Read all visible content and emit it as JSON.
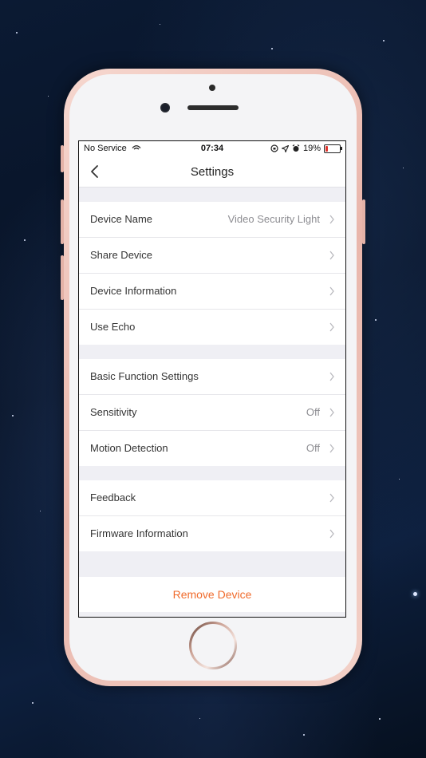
{
  "status_bar": {
    "carrier": "No Service",
    "time": "07:34",
    "battery_percent": "19%",
    "battery_level": 0.19
  },
  "nav": {
    "title": "Settings"
  },
  "groups": [
    [
      {
        "label": "Device Name",
        "value": "Video Security Light"
      },
      {
        "label": "Share Device",
        "value": ""
      },
      {
        "label": "Device Information",
        "value": ""
      },
      {
        "label": "Use Echo",
        "value": ""
      }
    ],
    [
      {
        "label": "Basic Function Settings",
        "value": ""
      },
      {
        "label": "Sensitivity",
        "value": "Off"
      },
      {
        "label": "Motion Detection",
        "value": "Off"
      }
    ],
    [
      {
        "label": "Feedback",
        "value": ""
      },
      {
        "label": "Firmware Information",
        "value": ""
      }
    ]
  ],
  "remove_label": "Remove Device",
  "colors": {
    "accent": "#f06b2c",
    "battery_low": "#e0342c"
  }
}
